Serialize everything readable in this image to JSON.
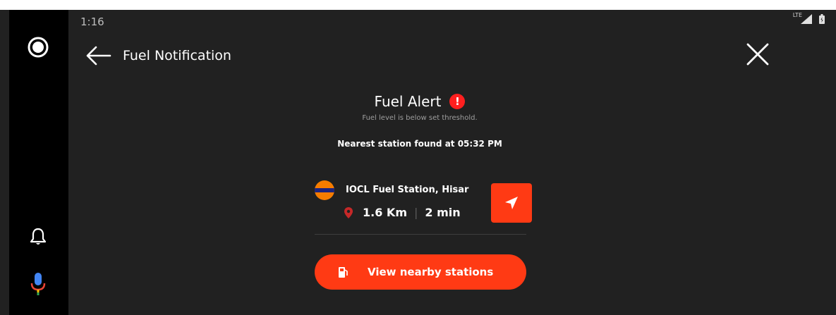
{
  "status": {
    "time": "1:16",
    "network": "LTE"
  },
  "header": {
    "title": "Fuel Notification"
  },
  "alert": {
    "title": "Fuel Alert",
    "icon_glyph": "!",
    "subtitle": "Fuel level is below set threshold.",
    "nearest": "Nearest station found at 05:32 PM"
  },
  "station": {
    "name": "IOCL Fuel Station, Hisar",
    "logo_text": "IndianOil",
    "distance": "1.6 Km",
    "separator": "|",
    "eta": "2 min"
  },
  "cta": {
    "label": "View nearby stations"
  },
  "colors": {
    "accent": "#ff3a14",
    "background": "#212121",
    "rail": "#000000"
  }
}
